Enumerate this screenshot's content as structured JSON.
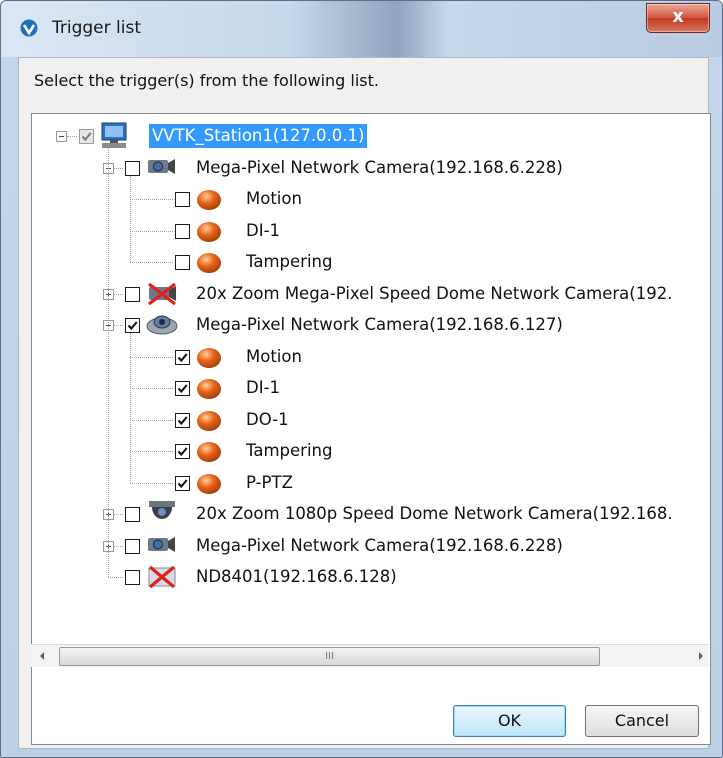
{
  "window": {
    "title": "Trigger list",
    "close_glyph": "x"
  },
  "instruction": "Select the trigger(s) from the following list.",
  "tree": {
    "root": {
      "label": "VVTK_Station1(127.0.0.1)",
      "checked": true,
      "grayed": true,
      "icon": "computer-icon"
    },
    "cameras": [
      {
        "label": "Mega-Pixel Network Camera(192.168.6.228)",
        "checked": false,
        "expanded": true,
        "icon": "box-camera-icon",
        "triggers": [
          {
            "label": "Motion",
            "checked": false
          },
          {
            "label": "DI-1",
            "checked": false
          },
          {
            "label": "Tampering",
            "checked": false
          }
        ]
      },
      {
        "label": "20x Zoom Mega-Pixel Speed Dome Network Camera(192.",
        "checked": false,
        "expanded": false,
        "icon": "disconnected-camera-icon"
      },
      {
        "label": "Mega-Pixel Network Camera(192.168.6.127)",
        "checked": true,
        "expanded": true,
        "icon": "fisheye-camera-icon",
        "triggers": [
          {
            "label": "Motion",
            "checked": true
          },
          {
            "label": "DI-1",
            "checked": true
          },
          {
            "label": "DO-1",
            "checked": true
          },
          {
            "label": "Tampering",
            "checked": true
          },
          {
            "label": "P-PTZ",
            "checked": true
          }
        ]
      },
      {
        "label": "20x Zoom 1080p Speed Dome Network Camera(192.168.",
        "checked": false,
        "expanded": false,
        "icon": "dome-camera-icon"
      },
      {
        "label": "Mega-Pixel Network Camera(192.168.6.228)",
        "checked": false,
        "expanded": false,
        "icon": "box-camera-icon"
      },
      {
        "label": "ND8401(192.168.6.128)",
        "checked": false,
        "expanded": null,
        "icon": "disconnected-nvr-icon"
      }
    ]
  },
  "scrollbar": {
    "thumb_glyph": "III"
  },
  "buttons": {
    "ok": "OK",
    "cancel": "Cancel"
  },
  "colors": {
    "selection": "#3399ff",
    "trigger_orb": "#e8641a"
  }
}
